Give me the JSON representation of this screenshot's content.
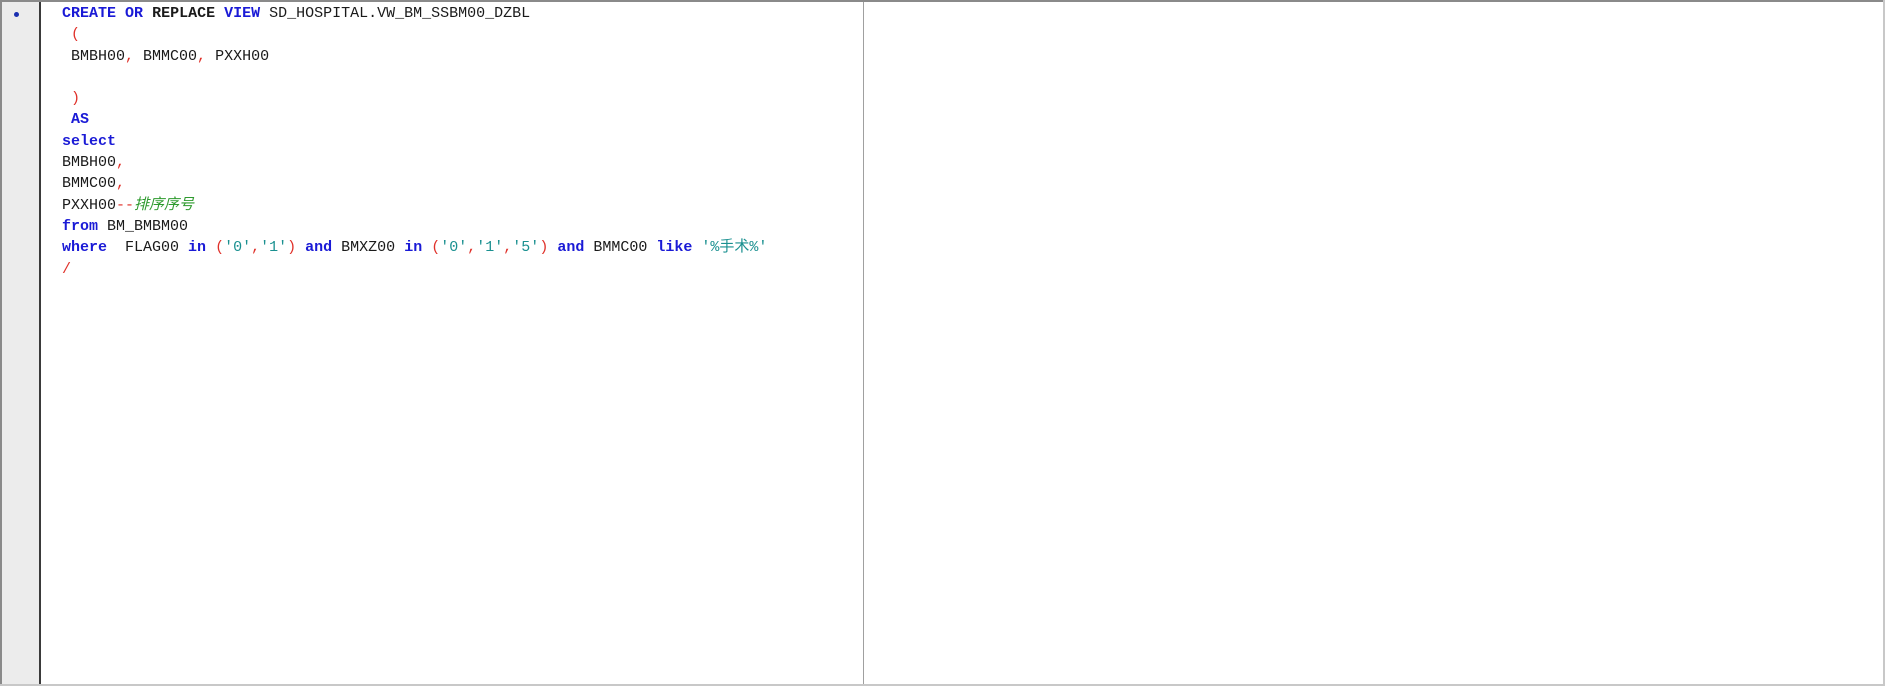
{
  "editor": {
    "gutter_marker": "breakpoint-dot",
    "lines": [
      {
        "parts": [
          {
            "t": "CREATE",
            "c": "kw"
          },
          {
            "t": " "
          },
          {
            "t": "OR",
            "c": "kw"
          },
          {
            "t": " "
          },
          {
            "t": "REPLACE",
            "c": "kw2"
          },
          {
            "t": " "
          },
          {
            "t": "VIEW",
            "c": "kw"
          },
          {
            "t": " SD_HOSPITAL.VW_BM_SSBM00_DZBL"
          }
        ]
      },
      {
        "parts": [
          {
            "t": " "
          },
          {
            "t": "(",
            "c": "op"
          }
        ]
      },
      {
        "parts": [
          {
            "t": " BMBH00"
          },
          {
            "t": ",",
            "c": "op"
          },
          {
            "t": " BMMC00"
          },
          {
            "t": ",",
            "c": "op"
          },
          {
            "t": " PXXH00"
          }
        ]
      },
      {
        "parts": [
          {
            "t": ""
          }
        ]
      },
      {
        "parts": [
          {
            "t": " "
          },
          {
            "t": ")",
            "c": "op"
          }
        ]
      },
      {
        "parts": [
          {
            "t": " "
          },
          {
            "t": "AS",
            "c": "kw"
          }
        ]
      },
      {
        "parts": [
          {
            "t": "select",
            "c": "kw"
          }
        ]
      },
      {
        "parts": [
          {
            "t": "BMBH00"
          },
          {
            "t": ",",
            "c": "op"
          }
        ]
      },
      {
        "parts": [
          {
            "t": "BMMC00"
          },
          {
            "t": ",",
            "c": "op"
          }
        ]
      },
      {
        "parts": [
          {
            "t": "PXXH00"
          },
          {
            "t": "--",
            "c": "op"
          },
          {
            "t": "排序序号",
            "c": "cmt"
          }
        ]
      },
      {
        "parts": [
          {
            "t": "from",
            "c": "kw"
          },
          {
            "t": " BM_BMBM00"
          }
        ]
      },
      {
        "parts": [
          {
            "t": "where",
            "c": "kw"
          },
          {
            "t": "  FLAG00 "
          },
          {
            "t": "in",
            "c": "kw"
          },
          {
            "t": " "
          },
          {
            "t": "(",
            "c": "op"
          },
          {
            "t": "'0'",
            "c": "str"
          },
          {
            "t": ",",
            "c": "op"
          },
          {
            "t": "'1'",
            "c": "str"
          },
          {
            "t": ")",
            "c": "op"
          },
          {
            "t": " "
          },
          {
            "t": "and",
            "c": "kw"
          },
          {
            "t": " BMXZ00 "
          },
          {
            "t": "in",
            "c": "kw"
          },
          {
            "t": " "
          },
          {
            "t": "(",
            "c": "op"
          },
          {
            "t": "'0'",
            "c": "str"
          },
          {
            "t": ",",
            "c": "op"
          },
          {
            "t": "'1'",
            "c": "str"
          },
          {
            "t": ",",
            "c": "op"
          },
          {
            "t": "'5'",
            "c": "str"
          },
          {
            "t": ")",
            "c": "op"
          },
          {
            "t": " "
          },
          {
            "t": "and",
            "c": "kw"
          },
          {
            "t": " BMMC00 "
          },
          {
            "t": "like",
            "c": "kw"
          },
          {
            "t": " "
          },
          {
            "t": "'%手术%'",
            "c": "str"
          }
        ]
      },
      {
        "parts": [
          {
            "t": "/",
            "c": "op"
          }
        ]
      }
    ]
  }
}
